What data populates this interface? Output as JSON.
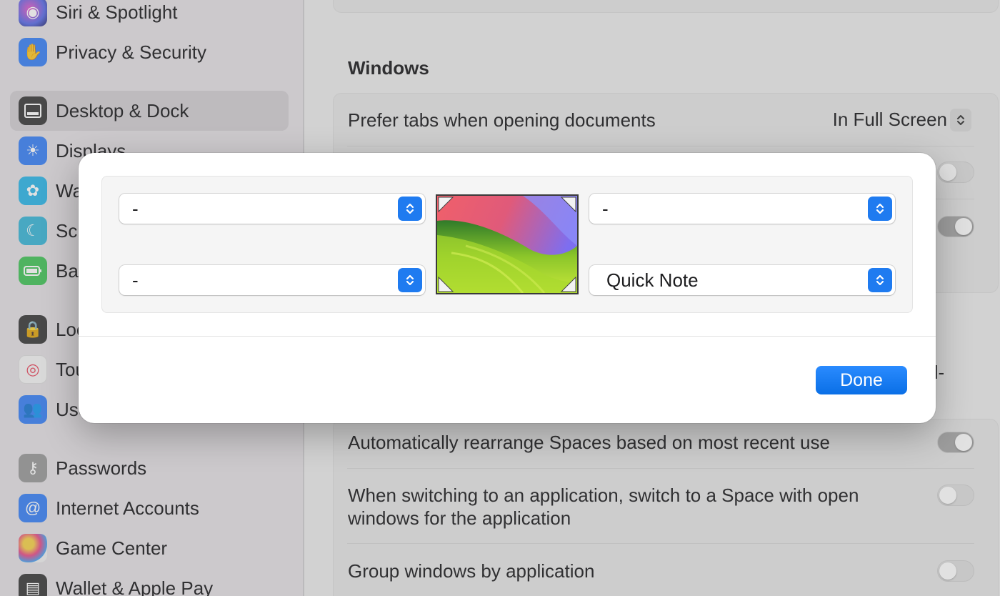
{
  "sidebar": {
    "items": [
      {
        "label": "Siri & Spotlight",
        "icon": "siri-icon",
        "color": "#8a5cc7"
      },
      {
        "label": "Privacy & Security",
        "icon": "hand-icon",
        "color": "#3a82f7"
      },
      {
        "label": "Desktop & Dock",
        "icon": "dock-icon",
        "color": "#3b3b3b"
      },
      {
        "label": "Displays",
        "icon": "sun-icon",
        "color": "#3a82f7"
      },
      {
        "label": "Wa",
        "icon": "flower-icon",
        "color": "#2fb7e8"
      },
      {
        "label": "Scr",
        "icon": "screensaver-icon",
        "color": "#3cb6d8"
      },
      {
        "label": "Bat",
        "icon": "battery-icon",
        "color": "#45c45a"
      },
      {
        "label": "Loc",
        "icon": "lock-icon",
        "color": "#3b3b3b"
      },
      {
        "label": "Tou",
        "icon": "fingerprint-icon",
        "color": "#f5f5f5"
      },
      {
        "label": "Use",
        "icon": "users-icon",
        "color": "#3a82f7"
      },
      {
        "label": "Passwords",
        "icon": "key-icon",
        "color": "#9a9a9a"
      },
      {
        "label": "Internet Accounts",
        "icon": "at-icon",
        "color": "#3a82f7"
      },
      {
        "label": "Game Center",
        "icon": "game-center-icon",
        "color": "#f0f0f0"
      },
      {
        "label": "Wallet & Apple Pay",
        "icon": "wallet-icon",
        "color": "#3b3b3b"
      }
    ]
  },
  "main": {
    "windows_title": "Windows",
    "prefer_tabs_label": "Prefer tabs when opening documents",
    "prefer_tabs_value": "In Full Screen",
    "partial_text": "ll-",
    "rearrange_label": "Automatically rearrange Spaces based on most recent use",
    "switch_space_label_1": "When switching to an application, switch to a Space with open",
    "switch_space_label_2": "windows for the application",
    "group_windows_label": "Group windows by application"
  },
  "hot_corners": {
    "top_left": "-",
    "top_right": "-",
    "bottom_left": "-",
    "bottom_right": "Quick Note",
    "done_label": "Done"
  },
  "colors": {
    "accent": "#1f7bf0",
    "sidebar_bg": "#e4e0e5"
  }
}
